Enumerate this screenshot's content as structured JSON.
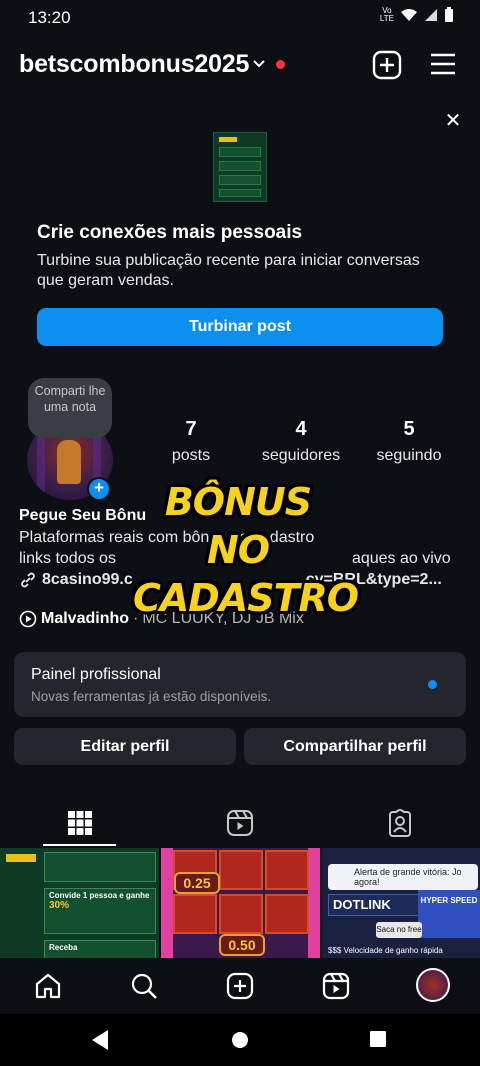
{
  "status_bar": {
    "time": "13:20",
    "volte_top": "Vo",
    "volte_bottom": "LTE"
  },
  "header": {
    "username": "betscombonus2025"
  },
  "promo": {
    "title": "Crie conexões mais pessoais",
    "text": "Turbine sua publicação recente para iniciar conversas que geram vendas.",
    "button": "Turbinar post",
    "close": "✕"
  },
  "profile": {
    "note": "Comparti lhe uma nota",
    "stats": [
      {
        "value": "7",
        "label": "posts"
      },
      {
        "value": "4",
        "label": "seguidores"
      },
      {
        "value": "5",
        "label": "seguindo"
      }
    ]
  },
  "bio": {
    "name": "Pegue Seu Bônu",
    "line1": "Plataformas reais com bônus no cadastro",
    "line2_left": "links todos os",
    "line2_right": "aques ao vivo",
    "link_left": "8casino99.c",
    "link_right": "cy=BRL&type=2..."
  },
  "music": {
    "song": "Malvadinho",
    "separator": "·",
    "artists": "MC LUUKY, DJ JB Mix"
  },
  "overlay": {
    "line1": "BÔNUS NO",
    "line2": "CADASTRO"
  },
  "pro_panel": {
    "title": "Painel profissional",
    "subtitle": "Novas ferramentas já estão disponíveis."
  },
  "actions": {
    "edit": "Editar perfil",
    "share": "Compartilhar perfil"
  },
  "grid": {
    "post1": {
      "row1": "Convide 1 pessoa e ganhe",
      "row1_value": "30%",
      "row2": "Receba"
    },
    "post2": {
      "coin1": "0.25",
      "coin2": "0.50"
    },
    "post3": {
      "alert": "Alerta de grande vitória: Jo agora!",
      "logo": "DOTLINK",
      "speed": "HYPER SPEED",
      "badge": "Saca no free",
      "foot": "$$$ Velocidade de ganho rápida"
    }
  },
  "colors": {
    "accent": "#0d8ff0",
    "notification": "#ff3040",
    "overlay_text": "#f7d21b",
    "background": "#0c0f14"
  }
}
